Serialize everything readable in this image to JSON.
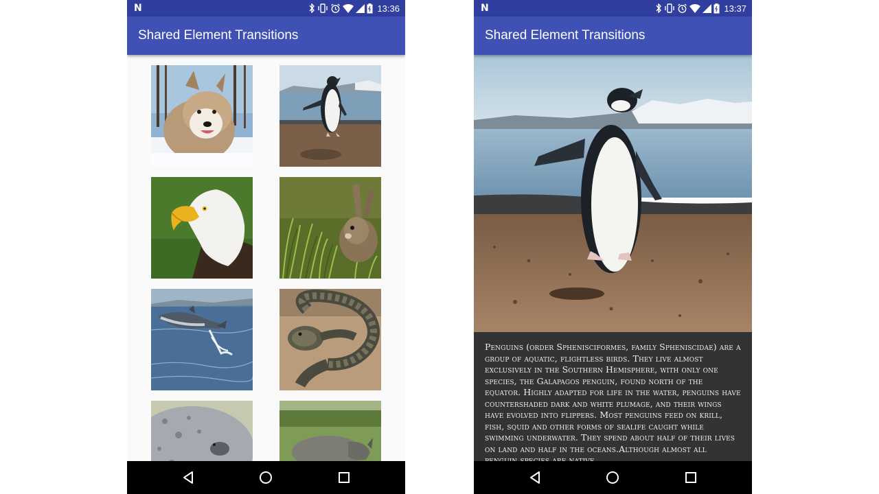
{
  "left_screen": {
    "status": {
      "time": "13:36"
    },
    "app_title": "Shared Element Transitions",
    "grid": [
      {
        "animal": "husky-dog"
      },
      {
        "animal": "penguin"
      },
      {
        "animal": "bald-eagle"
      },
      {
        "animal": "rabbit"
      },
      {
        "animal": "dolphin"
      },
      {
        "animal": "snake"
      },
      {
        "animal": "seal"
      },
      {
        "animal": "rhinoceros"
      }
    ]
  },
  "right_screen": {
    "status": {
      "time": "13:37"
    },
    "app_title": "Shared Element Transitions",
    "hero_image": "penguin",
    "description": "Penguins (order Sphenisciformes, family Spheniscidae) are a group of aquatic, flightless birds. They live almost exclusively in the Southern Hemisphere, with only one species, the Galapagos penguin, found north of the equator. Highly adapted for life in the water, penguins have countershaded dark and white plumage, and their wings have evolved into flippers. Most penguins feed on krill, fish, squid and other forms of sealife caught while swimming underwater. They spend about half of their lives on land and half in the oceans.Although almost all penguin species are native"
  },
  "icons": {
    "status_left": [
      "notification-n-icon"
    ],
    "status_right": [
      "bluetooth-icon",
      "vibrate-icon",
      "alarm-icon",
      "wifi-icon",
      "signal-icon",
      "battery-icon"
    ],
    "nav": [
      "back-icon",
      "home-icon",
      "recents-icon"
    ]
  },
  "colors": {
    "status_bar": "#303f9f",
    "app_bar": "#3f51b5",
    "description_bg": "#333333",
    "nav_bar": "#000000"
  }
}
